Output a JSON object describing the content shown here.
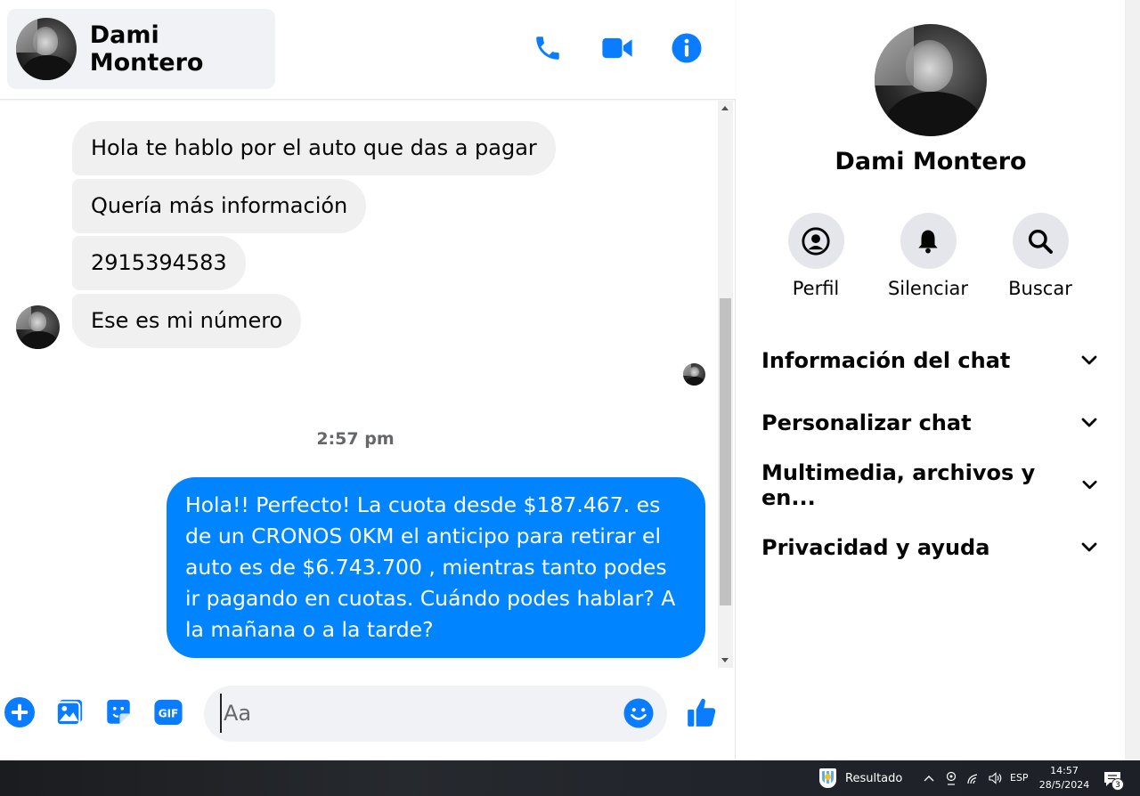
{
  "header": {
    "contact_name": "Dami Montero",
    "actions": [
      "phone-icon",
      "video-camera-icon",
      "info-icon"
    ]
  },
  "messages": {
    "incoming": [
      "Hola te hablo por el auto que das a pagar",
      "Quería más información",
      "2915394583",
      "Ese es mi número"
    ],
    "timestamp": "2:57 pm",
    "outgoing": "Hola!! Perfecto! La cuota desde $187.467. es de un CRONOS 0KM el anticipo para retirar el auto es de $6.743.700 , mientras tanto podes ir pagando en cuotas. Cuándo podes hablar? A la mañana o a la tarde?"
  },
  "composer": {
    "placeholder": "Aa",
    "buttons": [
      "plus-icon",
      "image-icon",
      "sticker-icon",
      "gif-icon",
      "emoji-icon",
      "like-icon"
    ],
    "gif_label": "GIF"
  },
  "info_panel": {
    "name": "Dami Montero",
    "actions": [
      {
        "label": "Perfil",
        "icon": "profile-icon"
      },
      {
        "label": "Silenciar",
        "icon": "bell-icon"
      },
      {
        "label": "Buscar",
        "icon": "search-icon"
      }
    ],
    "sections": [
      "Información del chat",
      "Personalizar chat",
      "Multimedia, archivos y en...",
      "Privacidad y ayuda"
    ]
  },
  "taskbar": {
    "weather_label": "Resultado",
    "language": "ESP",
    "time": "14:57",
    "date": "28/5/2024",
    "notification_count": "3"
  },
  "colors": {
    "messenger_blue": "#0084ff",
    "incoming_bubble": "#f0f0f0",
    "icon_blue": "#0a7cff",
    "secondary_text": "#65676b"
  }
}
